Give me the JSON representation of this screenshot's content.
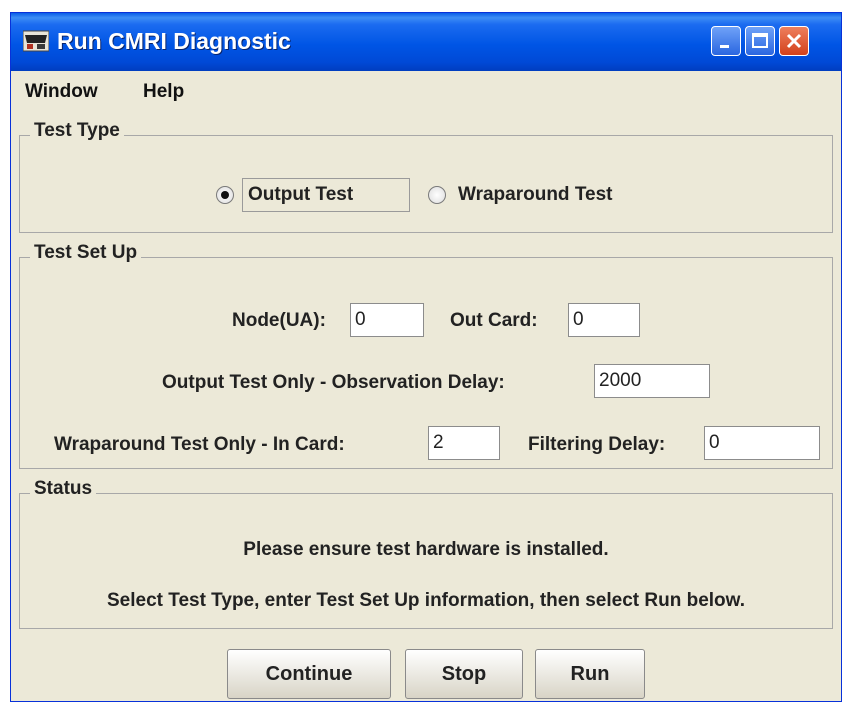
{
  "window": {
    "title": "Run CMRI Diagnostic"
  },
  "menu": [
    "Window",
    "Help"
  ],
  "test_type": {
    "legend": "Test Type",
    "options": [
      {
        "label": "Output Test",
        "selected": true
      },
      {
        "label": "Wraparound Test",
        "selected": false
      }
    ]
  },
  "setup": {
    "legend": "Test Set Up",
    "node_label": "Node(UA):",
    "node_value": "0",
    "out_card_label": "Out Card:",
    "out_card_value": "0",
    "obs_delay_label": "Output Test Only - Observation Delay:",
    "obs_delay_value": "2000",
    "in_card_label": "Wraparound Test Only - In Card:",
    "in_card_value": "2",
    "filter_label": "Filtering Delay:",
    "filter_value": "0"
  },
  "status": {
    "legend": "Status",
    "line1": "Please ensure test hardware is installed.",
    "line2": "Select Test Type, enter Test Set Up information, then select Run below."
  },
  "buttons": {
    "continue": "Continue",
    "stop": "Stop",
    "run": "Run"
  }
}
